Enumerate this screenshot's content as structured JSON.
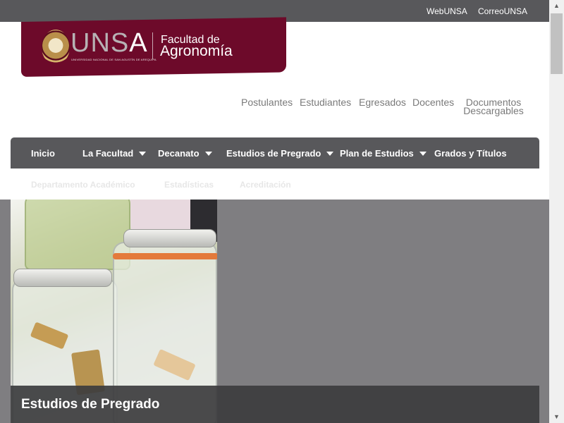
{
  "topbar": {
    "links": [
      "WebUNSA",
      "CorreoUNSA"
    ],
    "bg_color": "#58585b"
  },
  "logo": {
    "wordmark_main": "UNS",
    "wordmark_accent": "A",
    "subtitle": "UNIVERSIDAD NACIONAL DE SAN AGUSTÍN DE AREQUIPA",
    "faculty_line1": "Facultad de",
    "faculty_line2": "Agronomía",
    "brand_color": "#6d0a2a"
  },
  "subnav": {
    "items": [
      "Postulantes",
      "Estudiantes",
      "Egresados",
      "Docentes"
    ],
    "documentos_line1": "Documentos",
    "documentos_line2": "Descargables"
  },
  "mainnav": {
    "items": [
      "Inicio",
      "La Facultad",
      "Decanato",
      "Estudios de Pregrado",
      "Plan de Estudios",
      "Grados y Títulos"
    ],
    "row2": [
      "Departamento Académico",
      "Estadísticas",
      "Acreditación"
    ]
  },
  "hero": {
    "caption": "Estudios de Pregrado"
  },
  "icons": {
    "dropdown": "chevron-down-icon",
    "scroll_up": "scroll-up-icon",
    "scroll_down": "scroll-down-icon"
  }
}
